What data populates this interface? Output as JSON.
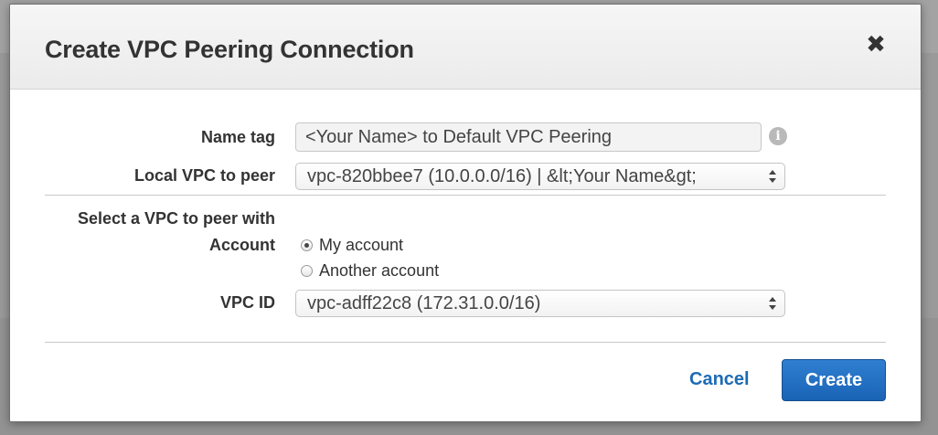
{
  "dialog": {
    "title": "Create VPC Peering Connection",
    "close_symbol": "✖"
  },
  "form": {
    "name_tag": {
      "label": "Name tag",
      "value": "<Your Name> to Default VPC Peering",
      "info_icon": "info-icon"
    },
    "local_vpc": {
      "label": "Local VPC to peer",
      "selected": "vpc-820bbee7 (10.0.0.0/16) | &lt;Your Name&gt;"
    },
    "peer_section": {
      "heading": "Select a VPC to peer with",
      "account_label": "Account",
      "account_options": [
        {
          "label": "My account",
          "checked": true
        },
        {
          "label": "Another account",
          "checked": false
        }
      ],
      "vpc_id_label": "VPC ID",
      "vpc_id_selected": "vpc-adff22c8 (172.31.0.0/16)"
    }
  },
  "footer": {
    "cancel_label": "Cancel",
    "create_label": "Create"
  },
  "colors": {
    "primary_button": "#1a63b5",
    "link": "#1c6bb4"
  }
}
